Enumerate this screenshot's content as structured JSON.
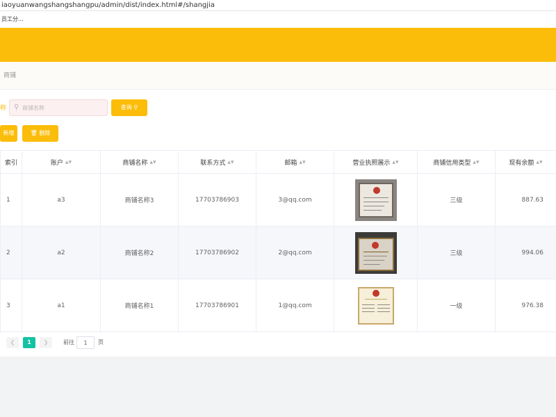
{
  "browser": {
    "url": "iaoyuanwangshangshangpu/admin/dist/index.html#/shangjia",
    "bookmark": "员工分..."
  },
  "breadcrumb": "商铺",
  "search": {
    "label": "称",
    "placeholder": "商铺名称",
    "value": "",
    "query_label": "查询"
  },
  "actions": {
    "add_label": "新增",
    "delete_label": "删除"
  },
  "table": {
    "columns": [
      "索引",
      "账户",
      "商铺名称",
      "联系方式",
      "邮箱",
      "营业执照展示",
      "商铺信用类型",
      "现有余额"
    ],
    "rows": [
      {
        "index": "1",
        "account": "a3",
        "name": "商铺名称3",
        "phone": "17703786903",
        "email": "3@qq.com",
        "credit": "三级",
        "balance": "887.63"
      },
      {
        "index": "2",
        "account": "a2",
        "name": "商铺名称2",
        "phone": "17703786902",
        "email": "2@qq.com",
        "credit": "三级",
        "balance": "994.06"
      },
      {
        "index": "3",
        "account": "a1",
        "name": "商铺名称1",
        "phone": "17703786901",
        "email": "1@qq.com",
        "credit": "一级",
        "balance": "976.38"
      }
    ]
  },
  "pagination": {
    "current": "1",
    "goto_label": "前往",
    "goto_value": "1",
    "unit": "页"
  },
  "colors": {
    "accent": "#fbbd0a",
    "page_active": "#13c2a3"
  }
}
